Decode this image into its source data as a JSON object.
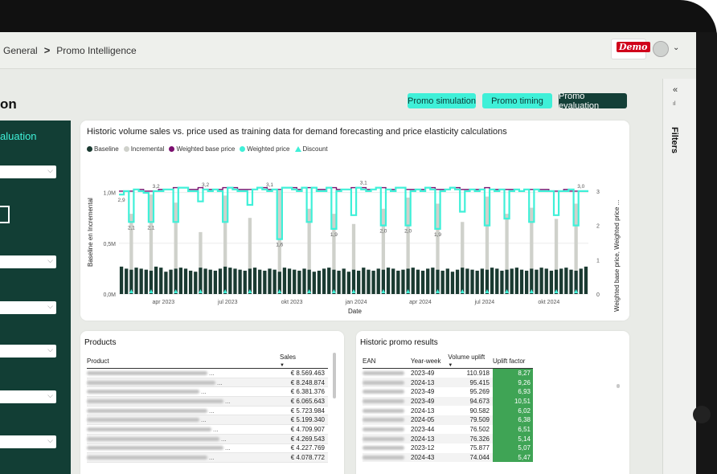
{
  "breadcrumb": {
    "parent": "General",
    "sep": ">",
    "current": "Promo Intelligence"
  },
  "header": {
    "logo_text": "Demo",
    "page_title": "on"
  },
  "nav_buttons": [
    {
      "label": "Promo simulation",
      "active": false
    },
    {
      "label": "Promo timing",
      "active": false
    },
    {
      "label": "Promo evaluation",
      "active": true
    }
  ],
  "left_panel": {
    "title": "aluation"
  },
  "filters": {
    "collapse": "«",
    "label": "Filters"
  },
  "colors": {
    "teal_dark": "#123e35",
    "accent": "#3ff0d8",
    "bar": "#1a3a31",
    "incremental": "#cfd1cb",
    "weighted_base": "#7b0f6f",
    "uplift_green": "#3fa455"
  },
  "chart_data": {
    "type": "bar",
    "title": "Historic volume sales vs. price used as training data for demand forecasting and price elasticity calculations",
    "legend": [
      "Baseline",
      "Incremental",
      "Weighted base price",
      "Weighted price",
      "Discount"
    ],
    "xlabel": "Date",
    "ylabel": "Baseline en Incremental",
    "y2label": "Weighted base price, Weighted price ...",
    "y_ticks": [
      "0,0M",
      "0,5M",
      "1,0M"
    ],
    "y2_ticks": [
      "0",
      "1",
      "2",
      "3"
    ],
    "x_ticks": [
      "apr 2023",
      "jul 2023",
      "okt 2023",
      "jan 2024",
      "apr 2024",
      "jul 2024",
      "okt 2024"
    ],
    "ylim": [
      0,
      1.25
    ],
    "y2lim": [
      0,
      3.7
    ],
    "x_range_weeks": 95,
    "baseline": [
      0.27,
      0.25,
      0.24,
      0.26,
      0.25,
      0.24,
      0.23,
      0.27,
      0.26,
      0.22,
      0.24,
      0.25,
      0.26,
      0.25,
      0.23,
      0.22,
      0.26,
      0.25,
      0.24,
      0.23,
      0.25,
      0.27,
      0.26,
      0.25,
      0.24,
      0.23,
      0.25,
      0.26,
      0.24,
      0.23,
      0.25,
      0.24,
      0.22,
      0.26,
      0.25,
      0.24,
      0.23,
      0.25,
      0.24,
      0.22,
      0.23,
      0.25,
      0.26,
      0.24,
      0.23,
      0.25,
      0.22,
      0.24,
      0.23,
      0.26,
      0.24,
      0.23,
      0.25,
      0.24,
      0.26,
      0.25,
      0.23,
      0.24,
      0.25,
      0.26,
      0.24,
      0.23,
      0.25,
      0.26,
      0.24,
      0.23,
      0.25,
      0.22,
      0.24,
      0.26,
      0.25,
      0.24,
      0.23,
      0.25,
      0.24,
      0.26,
      0.25,
      0.23,
      0.24,
      0.25,
      0.26,
      0.24,
      0.23,
      0.25,
      0.24,
      0.26,
      0.25,
      0.23,
      0.24,
      0.25,
      0.26,
      0.24,
      0.23,
      0.25,
      0.27
    ],
    "incremental": [
      0,
      0,
      0.55,
      0,
      0,
      0,
      0.75,
      0,
      0,
      0,
      0,
      0.65,
      0,
      0,
      0,
      0,
      0.35,
      0,
      0,
      0,
      0,
      0.7,
      0,
      0,
      0,
      0,
      0.5,
      0,
      0,
      0,
      0,
      0,
      0.8,
      0,
      0,
      0,
      0,
      0,
      0.6,
      0,
      0,
      0,
      0,
      0.55,
      0,
      0,
      0,
      0.45,
      0,
      0,
      0,
      0,
      0,
      0.6,
      0,
      0,
      0,
      0,
      0.7,
      0,
      0,
      0,
      0,
      0,
      0.65,
      0,
      0,
      0,
      0,
      0.45,
      0,
      0,
      0,
      0,
      0.72,
      0,
      0,
      0,
      0.55,
      0,
      0,
      0,
      0,
      0.6,
      0,
      0,
      0,
      0,
      0.5,
      0,
      0,
      0,
      0.66,
      0,
      0
    ],
    "weighted_base_price": [
      3.0,
      3.0,
      3.0,
      3.05,
      3.05,
      3.0,
      3.0,
      3.0,
      3.05,
      3.05,
      3.05,
      3.1,
      3.1,
      3.1,
      3.05,
      3.05,
      3.1,
      3.05,
      3.05,
      3.05,
      3.05,
      3.1,
      3.1,
      3.1,
      3.05,
      3.05,
      3.05,
      3.05,
      3.1,
      3.1,
      3.05,
      3.05,
      3.05,
      3.1,
      3.1,
      3.1,
      3.05,
      3.1,
      3.1,
      3.1,
      3.05,
      3.05,
      3.1,
      3.1,
      3.05,
      3.05,
      3.05,
      3.1,
      3.1,
      3.1,
      3.05,
      3.05,
      3.1,
      3.1,
      3.05,
      3.05,
      3.1,
      3.1,
      3.05,
      3.05,
      3.05,
      3.05,
      3.1,
      3.1,
      3.05,
      3.05,
      3.05,
      3.1,
      3.1,
      3.05,
      3.05,
      3.05,
      3.05,
      3.05,
      3.1,
      3.05,
      3.05,
      3.05,
      3.05,
      3.05,
      3.05,
      3.0,
      3.05,
      3.05,
      3.05,
      3.05,
      3.05,
      3.0,
      3.0,
      3.0,
      3.05,
      3.0,
      3.0,
      3.0,
      3.0
    ],
    "weighted_price": [
      2.9,
      3.0,
      2.1,
      3.05,
      3.0,
      2.95,
      2.1,
      3.0,
      3.0,
      3.05,
      3.05,
      2.1,
      3.1,
      3.1,
      3.0,
      3.0,
      2.7,
      3.05,
      3.0,
      3.05,
      3.0,
      2.1,
      3.1,
      3.05,
      3.0,
      3.0,
      2.6,
      3.05,
      3.1,
      3.05,
      3.0,
      3.05,
      1.6,
      3.1,
      3.1,
      3.05,
      3.0,
      3.1,
      2.1,
      3.1,
      3.0,
      3.0,
      3.1,
      1.9,
      3.0,
      3.05,
      3.05,
      2.3,
      3.1,
      3.05,
      3.0,
      3.05,
      3.1,
      2.0,
      3.05,
      3.0,
      3.1,
      3.1,
      2.0,
      3.0,
      3.05,
      3.0,
      3.1,
      3.05,
      1.9,
      3.0,
      3.05,
      3.1,
      3.05,
      2.4,
      3.0,
      3.05,
      3.0,
      3.05,
      2.0,
      3.05,
      3.0,
      3.05,
      2.2,
      3.0,
      3.05,
      3.0,
      3.05,
      2.1,
      3.05,
      3.0,
      3.0,
      3.0,
      2.3,
      3.0,
      3.0,
      3.05,
      2.0,
      3.0,
      3.0
    ],
    "discount_weeks": [
      2,
      6,
      11,
      16,
      21,
      26,
      32,
      38,
      43,
      47,
      53,
      58,
      64,
      69,
      74,
      78,
      83,
      88,
      92
    ],
    "data_labels": [
      {
        "week": 0,
        "series": "weighted_price",
        "text": "2,9"
      },
      {
        "week": 2,
        "series": "weighted_price",
        "text": "2,1"
      },
      {
        "week": 6,
        "series": "weighted_price",
        "text": "2,1"
      },
      {
        "week": 7,
        "series": "weighted_base_price",
        "text": "3,2"
      },
      {
        "week": 17,
        "series": "weighted_base_price",
        "text": "3,2"
      },
      {
        "week": 32,
        "series": "weighted_price",
        "text": "1,6"
      },
      {
        "week": 30,
        "series": "weighted_base_price",
        "text": "3,1"
      },
      {
        "week": 43,
        "series": "weighted_price",
        "text": "1,9"
      },
      {
        "week": 49,
        "series": "weighted_base_price",
        "text": "3,1"
      },
      {
        "week": 53,
        "series": "weighted_price",
        "text": "2,0"
      },
      {
        "week": 58,
        "series": "weighted_price",
        "text": "2,0"
      },
      {
        "week": 64,
        "series": "weighted_price",
        "text": "1,9"
      },
      {
        "week": 93,
        "series": "weighted_base_price",
        "text": "3,0"
      }
    ]
  },
  "products": {
    "title": "Products",
    "col_product": "Product",
    "col_sales": "Sales",
    "rows": [
      {
        "sales": "€ 8.569.463"
      },
      {
        "sales": "€ 8.248.874"
      },
      {
        "sales": "€ 6.381.376"
      },
      {
        "sales": "€ 6.065.643"
      },
      {
        "sales": "€ 5.723.984"
      },
      {
        "sales": "€ 5.199.340"
      },
      {
        "sales": "€ 4.709.907"
      },
      {
        "sales": "€ 4.269.543"
      },
      {
        "sales": "€ 4.227.769"
      },
      {
        "sales": "€ 4.078.772"
      }
    ]
  },
  "promo_results": {
    "title": "Historic promo results",
    "col_ean": "EAN",
    "col_week": "Year-week",
    "col_volume": "Volume uplift",
    "col_factor": "Uplift factor",
    "rows": [
      {
        "week": "2023-49",
        "volume": "110.918",
        "factor": "8,27"
      },
      {
        "week": "2024-13",
        "volume": "95.415",
        "factor": "9,26"
      },
      {
        "week": "2023-49",
        "volume": "95.269",
        "factor": "6,93"
      },
      {
        "week": "2023-49",
        "volume": "94.673",
        "factor": "10,51"
      },
      {
        "week": "2024-13",
        "volume": "90.582",
        "factor": "6,02"
      },
      {
        "week": "2024-05",
        "volume": "79.509",
        "factor": "6,38"
      },
      {
        "week": "2023-44",
        "volume": "76.502",
        "factor": "6,51"
      },
      {
        "week": "2024-13",
        "volume": "76.326",
        "factor": "5,14"
      },
      {
        "week": "2023-12",
        "volume": "75.877",
        "factor": "5,07"
      },
      {
        "week": "2024-43",
        "volume": "74.044",
        "factor": "5,47"
      }
    ]
  }
}
